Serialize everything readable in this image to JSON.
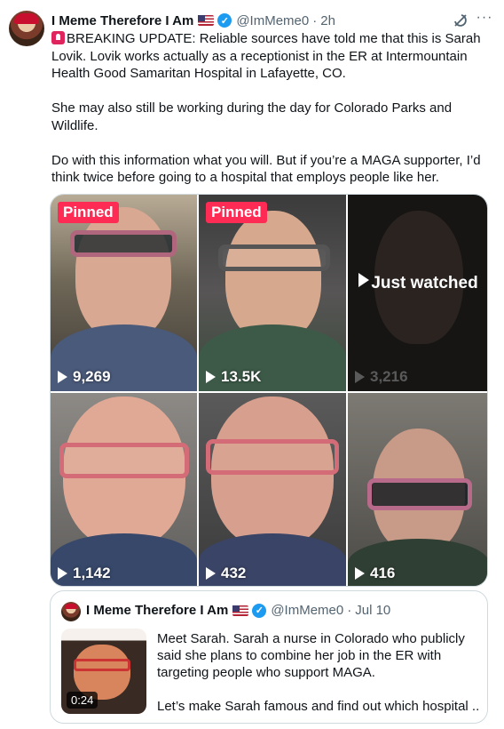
{
  "tweet": {
    "author_name": "I Meme Therefore I Am",
    "flag": "🇺🇸",
    "handle": "@ImMeme0",
    "time": "2h",
    "icons": {
      "avatar": "avatar",
      "verified": "verified-badge-icon",
      "grok": "grok-icon",
      "more": "more-icon",
      "siren": "siren-emoji-icon"
    },
    "paragraphs": [
      "BREAKING UPDATE: Reliable sources have told me that this is Sarah Lovik. Lovik works actually as a receptionist in the ER at Intermountain Health Good Samaritan Hospital in Lafayette, CO.",
      "She may also still be working during the day for Colorado Parks and Wildlife.",
      "Do with this information what you will. But if you’re a MAGA supporter, I’d think twice before going to a hospital that employs people like her."
    ]
  },
  "media": {
    "tiles": [
      {
        "pinned": "Pinned",
        "views": "9,269"
      },
      {
        "pinned": "Pinned",
        "views": "13.5K"
      },
      {
        "overlay": "Just watched",
        "views": "3,216"
      },
      {
        "views": "1,142"
      },
      {
        "views": "432"
      },
      {
        "views": "416"
      }
    ]
  },
  "quote": {
    "author_name": "I Meme Therefore I Am",
    "handle": "@ImMeme0",
    "date": "Jul 10",
    "video_duration": "0:24",
    "paragraphs": [
      "Meet Sarah. Sarah a nurse in Colorado who publicly said she plans to combine her job in the ER with targeting people who support MAGA.",
      "Let’s make Sarah famous and find out which hospital ..."
    ]
  },
  "colors": {
    "accent": "#1d9bf0",
    "pinned": "#fe2c55",
    "text": "#0f1419",
    "muted": "#536471"
  }
}
